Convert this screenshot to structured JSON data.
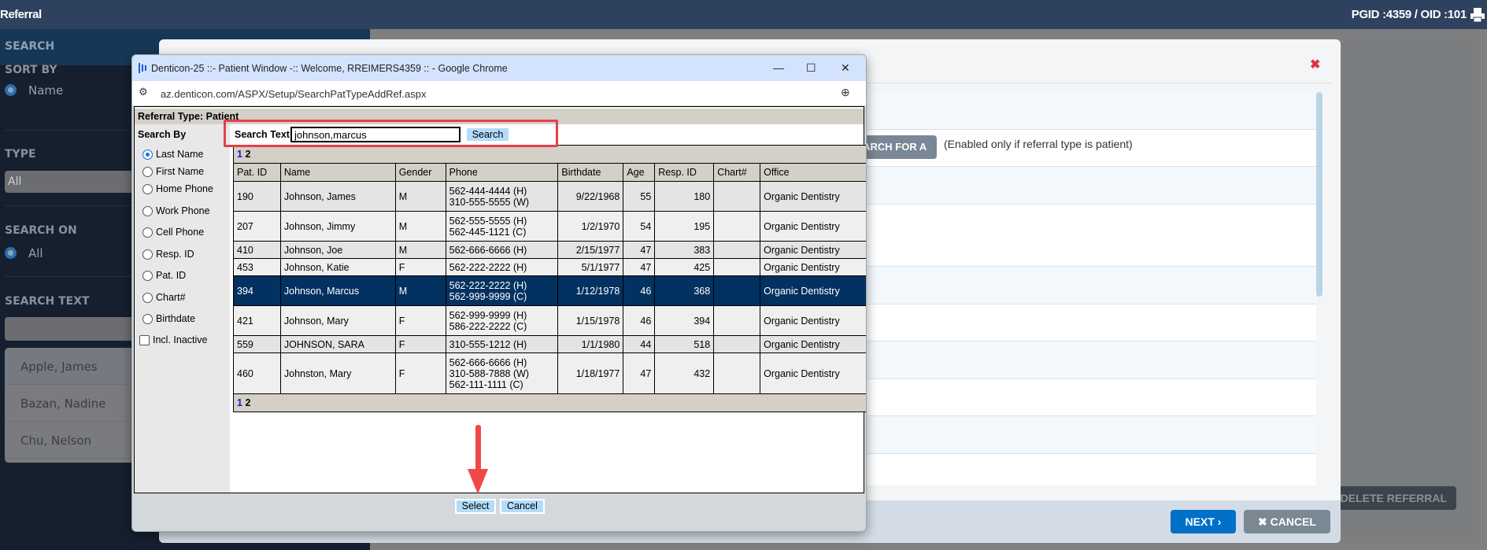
{
  "topbar": {
    "title": "Referral",
    "ids": "PGID :4359  /  OID :101"
  },
  "sidebar": {
    "header": "SEARCH",
    "sort_by": {
      "label": "SORT BY",
      "option": "Name"
    },
    "type": {
      "label": "TYPE",
      "value": "All"
    },
    "search_on": {
      "label": "SEARCH ON",
      "option": "All"
    },
    "search_text": {
      "label": "SEARCH TEXT",
      "value": ""
    },
    "patients": [
      "Apple, James",
      "Bazan, Nadine",
      "Chu, Nelson"
    ]
  },
  "modal": {
    "search_patient_label": "SEARCH FOR A PATIENT",
    "search_hint": "(Enabled only if referral type is patient)",
    "next_label": "NEXT ›",
    "cancel_label": "✖  CANCEL",
    "delete_label": "DELETE REFERRAL",
    "close_glyph": "✖"
  },
  "popup": {
    "window_title": "Denticon-25 ::- Patient Window -:: Welcome, RREIMERS4359 :: - Google Chrome",
    "url": "az.denticon.com/ASPX/Setup/SearchPatTypeAddRef.aspx",
    "referral_type": "Referral Type: Patient",
    "search_by_label": "Search By",
    "search_by_options": [
      "Last Name",
      "First Name",
      "Home Phone",
      "Work Phone",
      "Cell Phone",
      "Resp. ID",
      "Pat. ID",
      "Chart#",
      "Birthdate"
    ],
    "selected_option": "Last Name",
    "incl_inactive": "Incl. Inactive",
    "search_text_label": "Search Text :",
    "search_text_value": "johnson,marcus",
    "search_button": "Search",
    "pages": [
      "1",
      "2"
    ],
    "columns": [
      "Pat. ID",
      "Name",
      "Gender",
      "Phone",
      "Birthdate",
      "Age",
      "Resp. ID",
      "Chart#",
      "Office"
    ],
    "rows": [
      {
        "id": "190",
        "name": "Johnson, James",
        "gender": "M",
        "phones": [
          "562-444-4444 (H)",
          "310-555-5555 (W)"
        ],
        "birthdate": "9/22/1968",
        "age": "55",
        "resp": "180",
        "chart": "",
        "office": "Organic Dentistry"
      },
      {
        "id": "207",
        "name": "Johnson, Jimmy",
        "gender": "M",
        "phones": [
          "562-555-5555 (H)",
          "562-445-1121 (C)"
        ],
        "birthdate": "1/2/1970",
        "age": "54",
        "resp": "195",
        "chart": "",
        "office": "Organic Dentistry"
      },
      {
        "id": "410",
        "name": "Johnson, Joe",
        "gender": "M",
        "phones": [
          "562-666-6666 (H)"
        ],
        "birthdate": "2/15/1977",
        "age": "47",
        "resp": "383",
        "chart": "",
        "office": "Organic Dentistry"
      },
      {
        "id": "453",
        "name": "Johnson, Katie",
        "gender": "F",
        "phones": [
          "562-222-2222 (H)"
        ],
        "birthdate": "5/1/1977",
        "age": "47",
        "resp": "425",
        "chart": "",
        "office": "Organic Dentistry"
      },
      {
        "id": "394",
        "name": "Johnson, Marcus",
        "gender": "M",
        "phones": [
          "562-222-2222 (H)",
          "562-999-9999 (C)"
        ],
        "birthdate": "1/12/1978",
        "age": "46",
        "resp": "368",
        "chart": "",
        "office": "Organic Dentistry",
        "selected": true
      },
      {
        "id": "421",
        "name": "Johnson, Mary",
        "gender": "F",
        "phones": [
          "562-999-9999 (H)",
          "586-222-2222 (C)"
        ],
        "birthdate": "1/15/1978",
        "age": "46",
        "resp": "394",
        "chart": "",
        "office": "Organic Dentistry"
      },
      {
        "id": "559",
        "name": "JOHNSON, SARA",
        "gender": "F",
        "phones": [
          "310-555-1212 (H)"
        ],
        "birthdate": "1/1/1980",
        "age": "44",
        "resp": "518",
        "chart": "",
        "office": "Organic Dentistry"
      },
      {
        "id": "460",
        "name": "Johnston, Mary",
        "gender": "F",
        "phones": [
          "562-666-6666 (H)",
          "310-588-7888 (W)",
          "562-111-1111 (C)"
        ],
        "birthdate": "1/18/1977",
        "age": "47",
        "resp": "432",
        "chart": "",
        "office": "Organic Dentistry"
      }
    ],
    "select_label": "Select",
    "cancel_label": "Cancel"
  },
  "colors": {
    "topbar": "#2e4260",
    "selected_row": "#033160",
    "next": "#0070c8",
    "annotation": "#e5404a"
  }
}
